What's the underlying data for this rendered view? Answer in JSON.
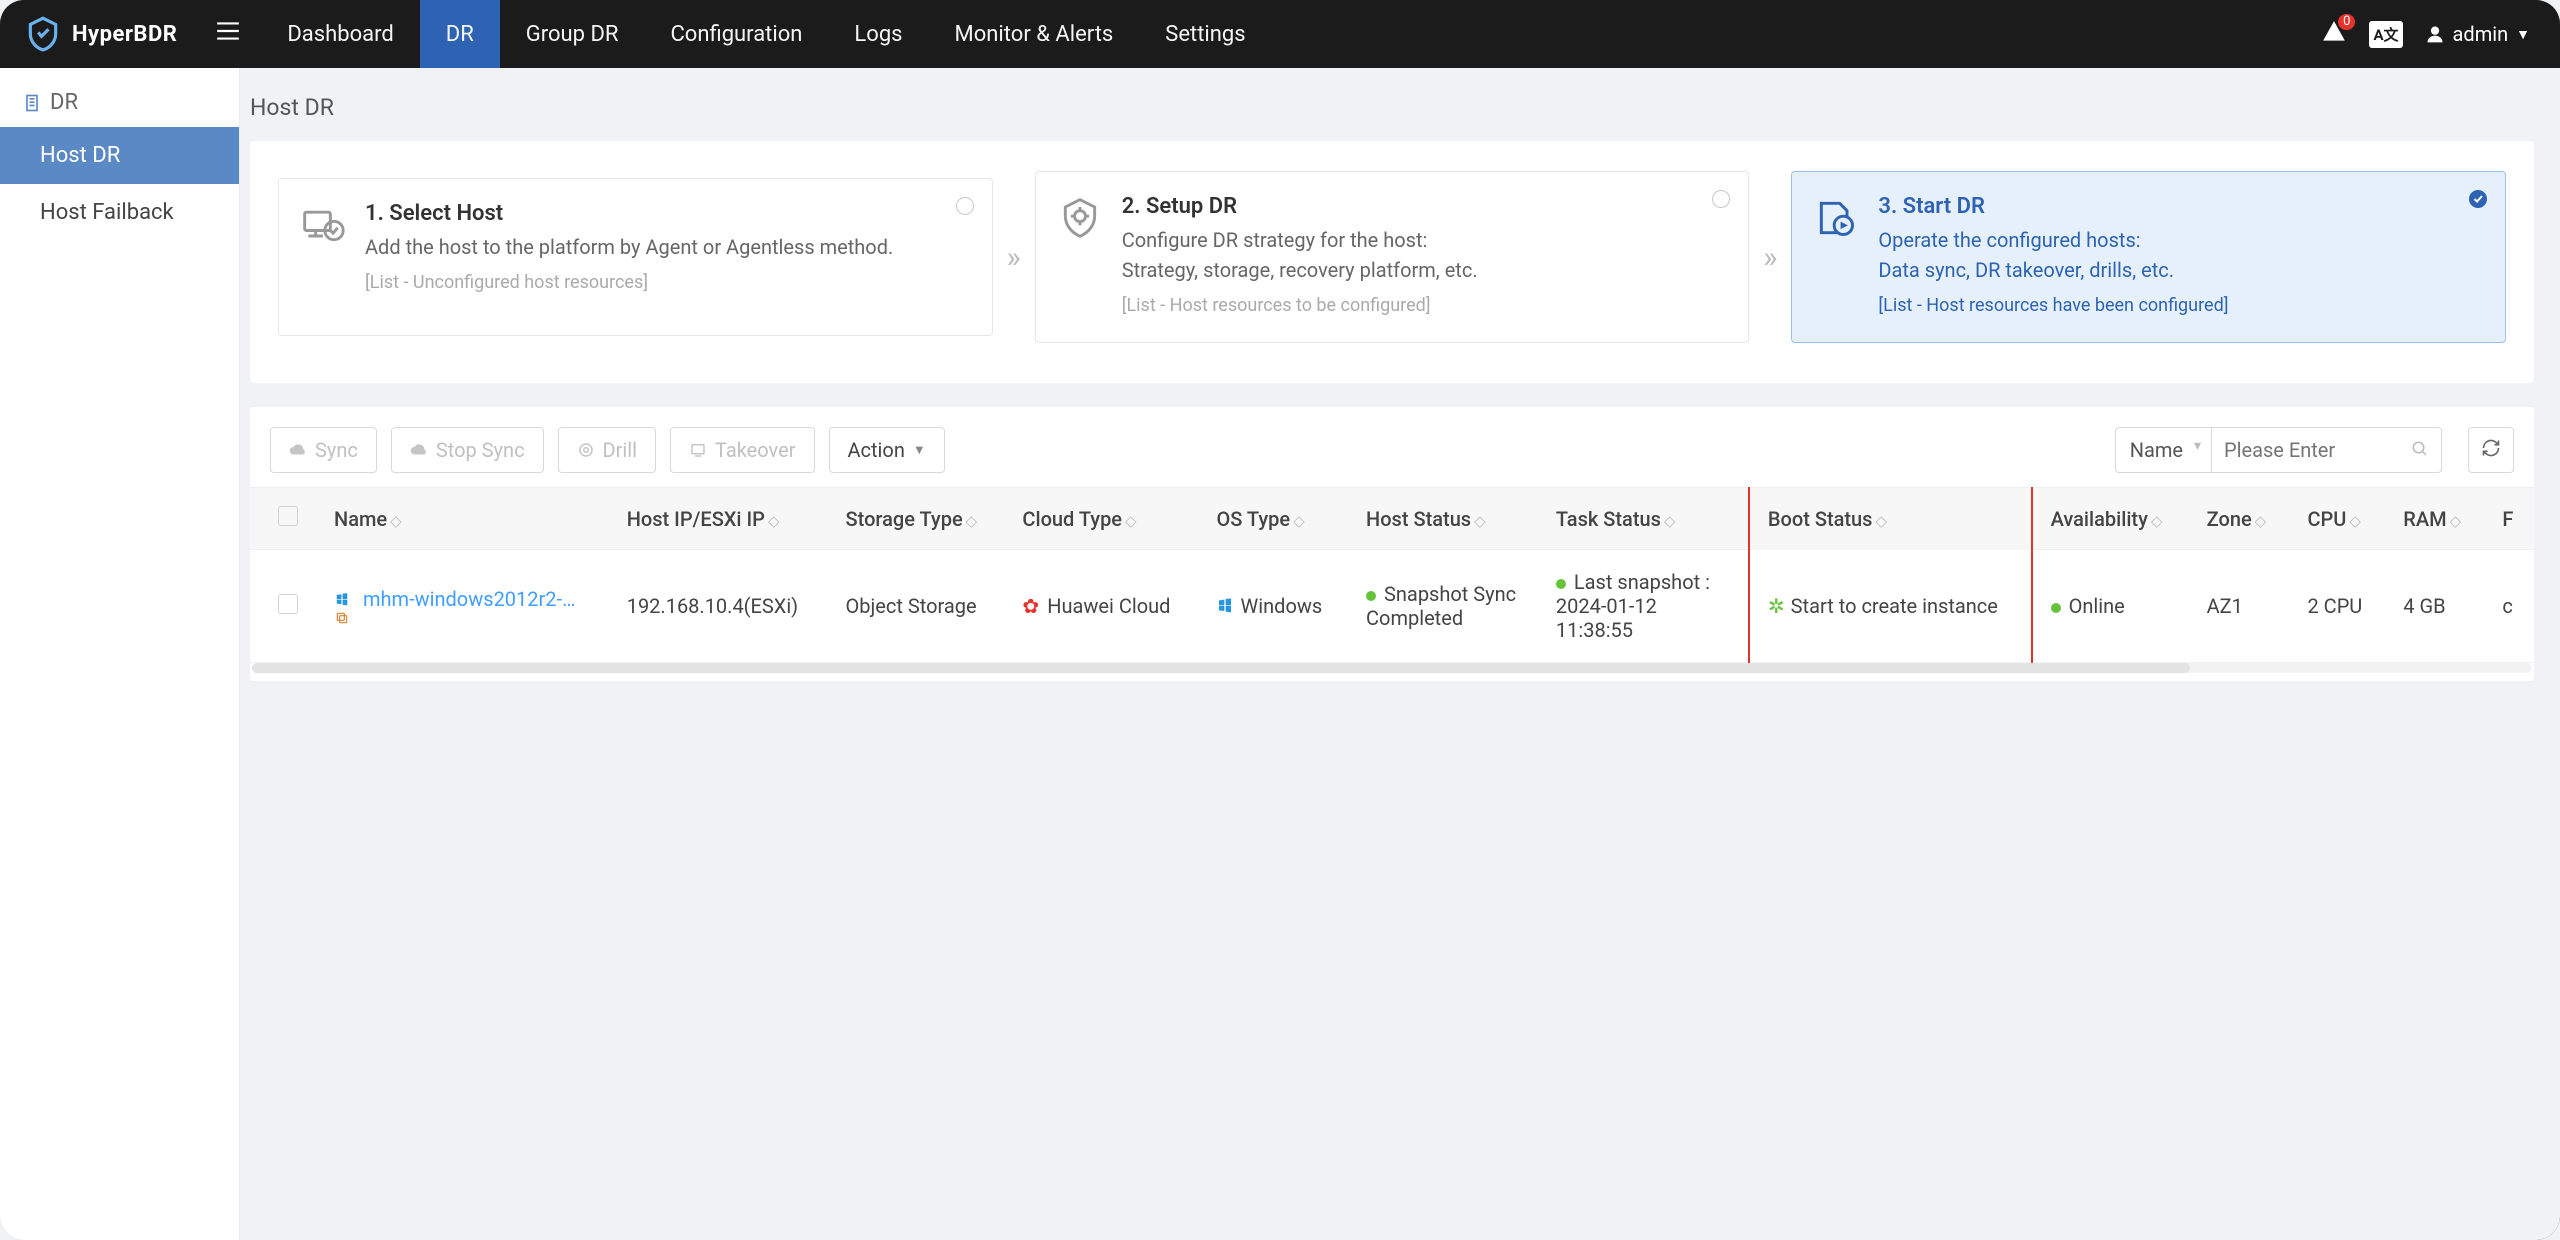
{
  "brand": "HyperBDR",
  "nav": {
    "items": [
      "Dashboard",
      "DR",
      "Group DR",
      "Configuration",
      "Logs",
      "Monitor & Alerts",
      "Settings"
    ],
    "active": "DR"
  },
  "top_right": {
    "alert_badge": "0",
    "lang": "A文",
    "user": "admin"
  },
  "sidebar": {
    "title": "DR",
    "items": [
      {
        "label": "Host DR",
        "active": true
      },
      {
        "label": "Host Failback",
        "active": false
      }
    ]
  },
  "page_title": "Host DR",
  "steps": [
    {
      "title": "1. Select Host",
      "desc": "Add the host to the platform by Agent or Agentless method.",
      "list": "[List - Unconfigured host resources]",
      "active": false
    },
    {
      "title": "2. Setup DR",
      "desc": "Configure DR strategy for the host:\nStrategy, storage, recovery platform, etc.",
      "list": "[List - Host resources to be configured]",
      "active": false
    },
    {
      "title": "3. Start DR",
      "desc": "Operate the configured hosts:\nData sync, DR takeover, drills, etc.",
      "list": "[List - Host resources have been configured]",
      "active": true
    }
  ],
  "toolbar": {
    "sync": "Sync",
    "stop_sync": "Stop Sync",
    "drill": "Drill",
    "takeover": "Takeover",
    "action": "Action",
    "filter_field": "Name",
    "search_placeholder": "Please Enter"
  },
  "table": {
    "headers": [
      "",
      "Name",
      "Host IP/ESXi IP",
      "Storage Type",
      "Cloud Type",
      "OS Type",
      "Host Status",
      "Task Status",
      "Boot Status",
      "Availability",
      "Zone",
      "CPU",
      "RAM",
      "F"
    ],
    "rows": [
      {
        "name": "mhm-windows2012r2-…",
        "host_ip": "192.168.10.4(ESXi)",
        "storage_type": "Object Storage",
        "cloud_type": "Huawei Cloud",
        "os_type": "Windows",
        "host_status": "Snapshot Sync Completed",
        "task_status": "Last snapshot : 2024-01-12 11:38:55",
        "boot_status": "Start to create instance",
        "availability": "Online",
        "zone": "AZ1",
        "cpu": "2 CPU",
        "ram": "4 GB",
        "flavor": "c"
      }
    ]
  }
}
